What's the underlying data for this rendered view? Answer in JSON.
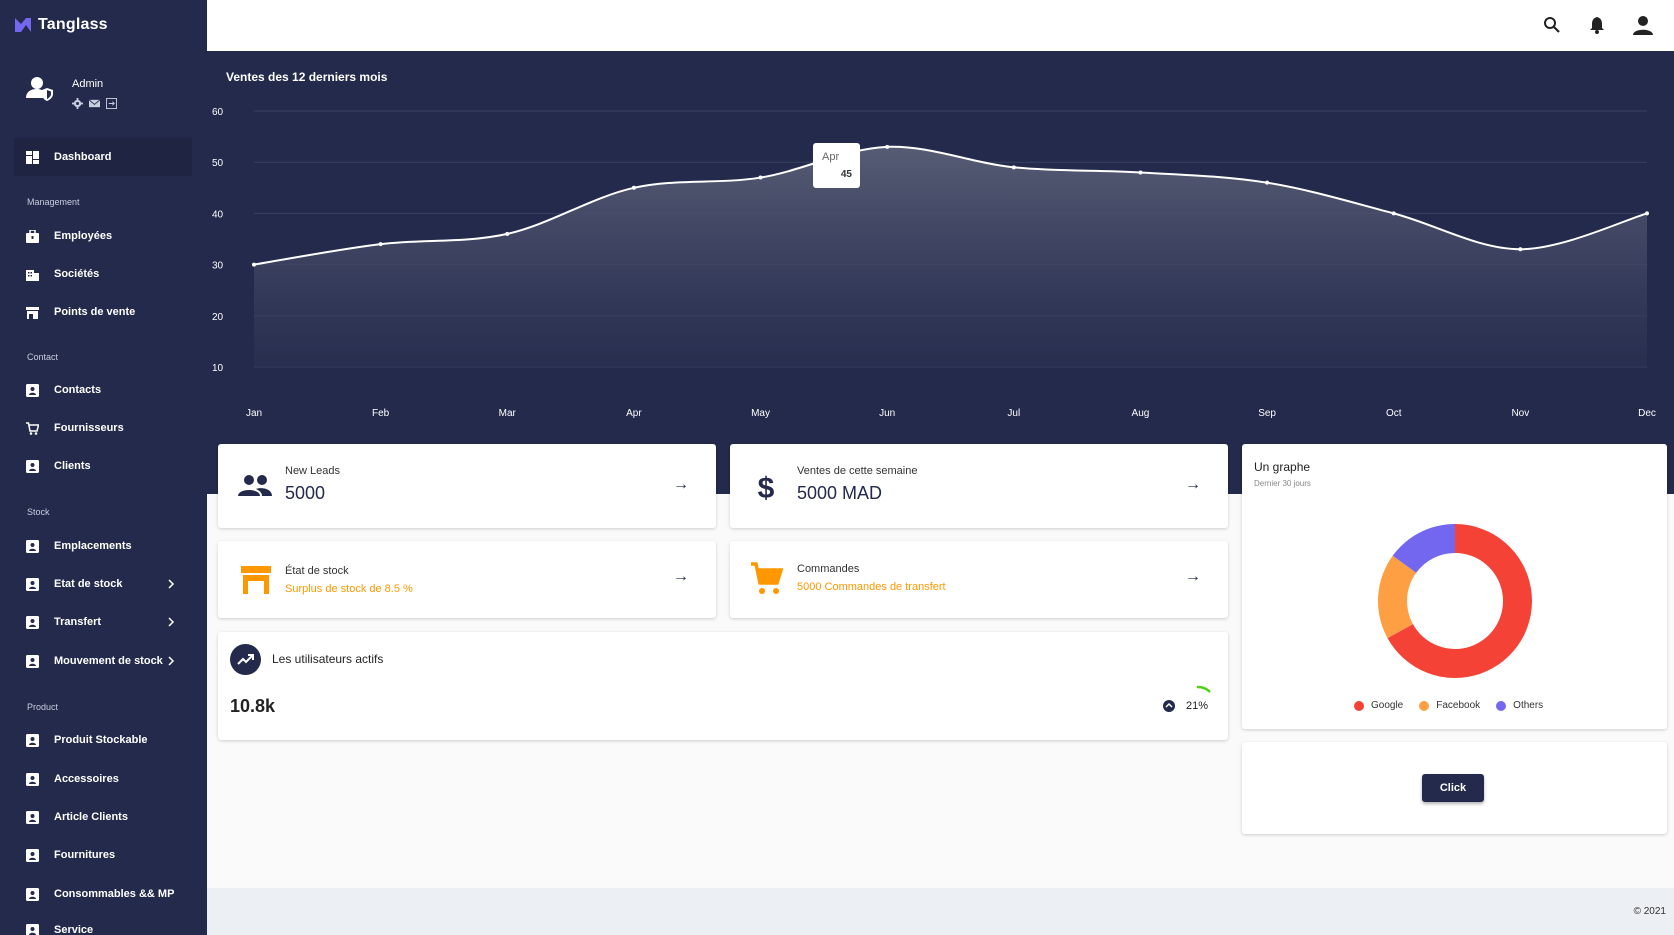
{
  "app": {
    "name": "Tanglass"
  },
  "user": {
    "name": "Admin"
  },
  "sidebar": {
    "dashboard": "Dashboard",
    "sections": {
      "management": "Management",
      "contact": "Contact",
      "stock": "Stock",
      "product": "Product"
    },
    "items": [
      {
        "label": "Employées",
        "icon": "briefcase-icon"
      },
      {
        "label": "Sociétés",
        "icon": "building-icon"
      },
      {
        "label": "Points de vente",
        "icon": "store-icon"
      },
      {
        "label": "Contacts",
        "icon": "contact-icon"
      },
      {
        "label": "Fournisseurs",
        "icon": "cart-icon"
      },
      {
        "label": "Clients",
        "icon": "contact-icon"
      },
      {
        "label": "Emplacements",
        "icon": "contact-icon"
      },
      {
        "label": "Etat de stock",
        "icon": "contact-icon"
      },
      {
        "label": "Transfert",
        "icon": "contact-icon"
      },
      {
        "label": "Mouvement de stock",
        "icon": "contact-icon"
      },
      {
        "label": "Produit Stockable",
        "icon": "contact-icon"
      },
      {
        "label": "Accessoires",
        "icon": "contact-icon"
      },
      {
        "label": "Article Clients",
        "icon": "contact-icon"
      },
      {
        "label": "Fournitures",
        "icon": "contact-icon"
      },
      {
        "label": "Consommables && MP",
        "icon": "contact-icon"
      },
      {
        "label": "Service",
        "icon": "contact-icon"
      }
    ]
  },
  "chart_data": {
    "type": "area",
    "title": "Ventes des 12 derniers mois",
    "categories": [
      "Jan",
      "Feb",
      "Mar",
      "Apr",
      "May",
      "Jun",
      "Jul",
      "Aug",
      "Sep",
      "Oct",
      "Nov",
      "Dec"
    ],
    "values": [
      30,
      34,
      36,
      45,
      47,
      53,
      49,
      48,
      46,
      40,
      33,
      40
    ],
    "yticks": [
      10,
      20,
      30,
      40,
      50,
      60
    ],
    "ylim": [
      10,
      60
    ],
    "grid": true,
    "line_color": "#ffffff",
    "tooltip": {
      "label": "Apr",
      "value": "45"
    }
  },
  "kpis": {
    "leads": {
      "label": "New Leads",
      "value": "5000"
    },
    "sales": {
      "label": "Ventes de cette semaine",
      "value": "5000 MAD"
    },
    "stock": {
      "label": "État de stock",
      "sub": "Surplus de stock de  8.5 %"
    },
    "orders": {
      "label": "Commandes",
      "sub": "5000 Commandes de transfert"
    },
    "arrow": "→"
  },
  "active_users": {
    "title": "Les utilisateurs actifs",
    "value": "10.8k",
    "percent": "21%",
    "progress": 0.21
  },
  "donut": {
    "title": "Un graphe",
    "subtitle": "Dernier 30 jours",
    "slices": [
      {
        "label": "Google",
        "value": 67,
        "color": "#f44336"
      },
      {
        "label": "Facebook",
        "value": 18,
        "color": "#ff9f43"
      },
      {
        "label": "Others",
        "value": 15,
        "color": "#7367f0"
      }
    ]
  },
  "button": {
    "label": "Click"
  },
  "footer": {
    "copyright": "© 2021"
  }
}
